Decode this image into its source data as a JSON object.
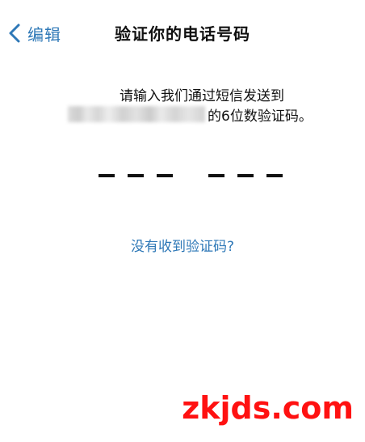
{
  "header": {
    "back_label": "编辑",
    "back_icon": "chevron-left-icon",
    "title": "验证你的电话号码"
  },
  "instructions": {
    "line1": "请输入我们通过短信发送到",
    "line2_suffix": "的6位数验证码。"
  },
  "code_input": {
    "digit_count": 6,
    "entered": ""
  },
  "resend": {
    "label": "没有收到验证码?"
  },
  "watermark": {
    "text": "zkjds.com"
  },
  "colors": {
    "accent": "#2e78b7",
    "text": "#111111",
    "watermark": "#ff1111",
    "background": "#ffffff"
  }
}
